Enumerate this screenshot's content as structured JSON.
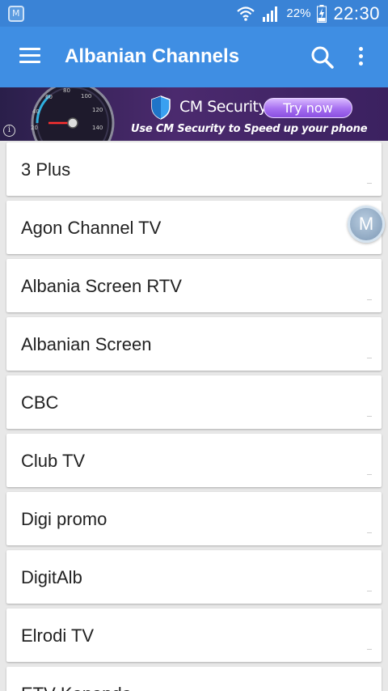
{
  "status_bar": {
    "battery_percent": "22%",
    "time": "22:30",
    "icons": [
      "app-notification-icon",
      "wifi-icon",
      "signal-icon",
      "battery-charging-icon"
    ]
  },
  "app_bar": {
    "title": "Albanian Channels",
    "icons": [
      "menu-icon",
      "search-icon",
      "more-vert-icon"
    ],
    "color": "#3f8ee3"
  },
  "ad": {
    "brand": "CM Security",
    "cta": "Try now",
    "tagline": "Use CM Security to Speed up your phone",
    "gauge_ticks": [
      "60",
      "80",
      "100",
      "40",
      "120",
      "20",
      "140"
    ],
    "info_icon": "info-icon"
  },
  "channels": [
    "3 Plus",
    "Agon Channel TV",
    "Albania Screen RTV",
    "Albanian Screen",
    "CBC",
    "Club TV",
    "Digi promo",
    "DigitAlb",
    "Elrodi TV",
    "ETV Kanapda"
  ],
  "floating_button": {
    "label": "M"
  }
}
